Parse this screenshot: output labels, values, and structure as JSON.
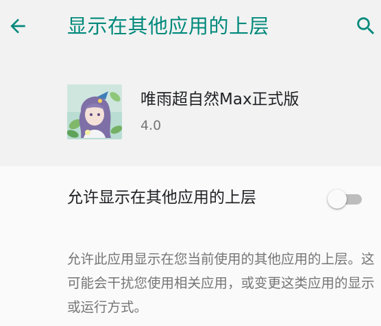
{
  "appbar": {
    "title": "显示在其他应用的上层",
    "back_icon": "arrow-back-icon",
    "search_icon": "search-icon",
    "accent_color": "#00897b"
  },
  "app": {
    "name": "唯雨超自然Max正式版",
    "version": "4.0",
    "icon": "app-icon-illustration"
  },
  "setting": {
    "label": "允许显示在其他应用的上层",
    "enabled": false
  },
  "description": "允许此应用显示在您当前使用的其他应用的上层。这可能会干扰您使用相关应用，或变更这类应用的显示或运行方式。"
}
